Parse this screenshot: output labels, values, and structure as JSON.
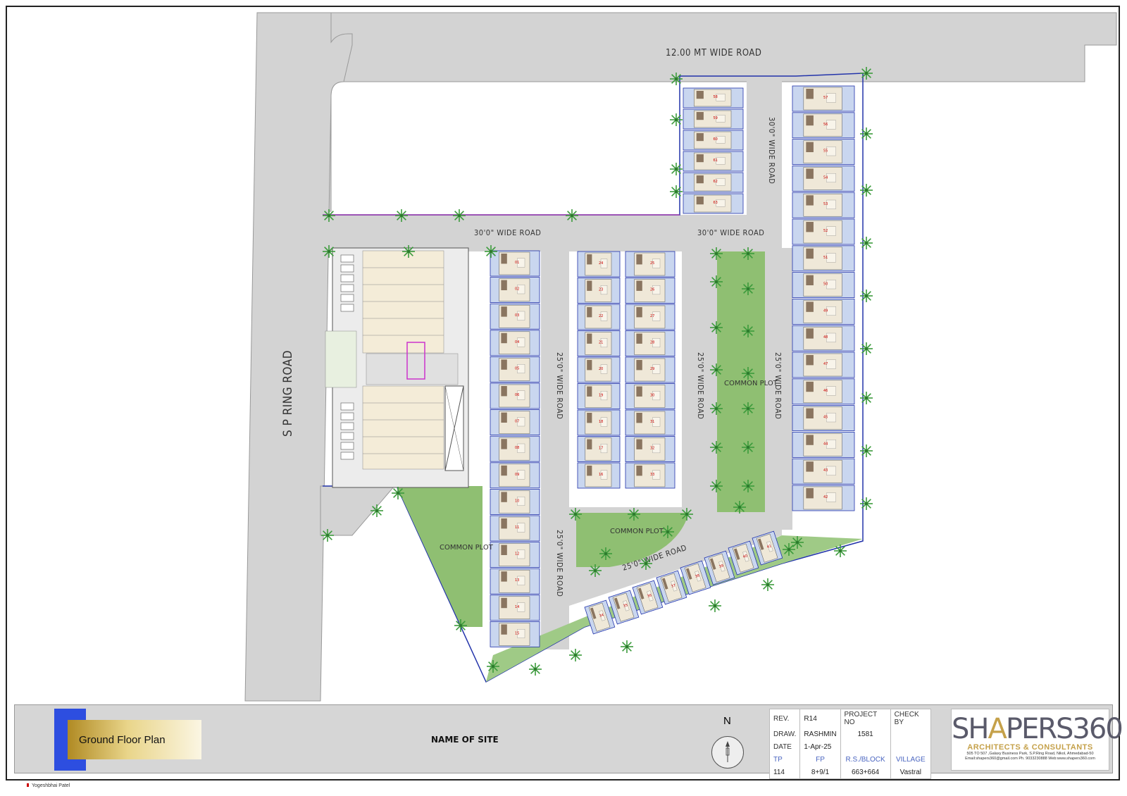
{
  "roads": {
    "top": "12.00 MT  WIDE ROAD",
    "left": "S P RING ROAD",
    "r30_right_vertical": "30'0\" WIDE ROAD",
    "r30_left": "30'0\" WIDE ROAD",
    "r30_mid": "30'0\" WIDE ROAD",
    "r25_a": "25'0\" WIDE ROAD",
    "r25_b": "25'0\" WIDE ROAD",
    "r25_c": "25'0\" WIDE ROAD",
    "r25_d": "25'0\" WIDE ROAD",
    "r25_e": "25'0\" WIDE ROAD"
  },
  "plots": {
    "common_plot_1": "COMMON PLOT",
    "common_plot_2": "COMMON PLOT",
    "common_plot_3": "COMMON PLOT"
  },
  "units": {
    "col1": [
      "01",
      "02",
      "03",
      "04",
      "05",
      "06",
      "07",
      "08",
      "09",
      "10",
      "11",
      "12",
      "13",
      "14",
      "15"
    ],
    "col2": [
      "24",
      "23",
      "22",
      "21",
      "20",
      "19",
      "18",
      "17",
      "16"
    ],
    "col3": [
      "25",
      "26",
      "27",
      "28",
      "29",
      "30",
      "31",
      "32",
      "33"
    ],
    "col_top": [
      "58",
      "59",
      "60",
      "61",
      "62",
      "63"
    ],
    "col_right": [
      "57",
      "56",
      "55",
      "54",
      "53",
      "52",
      "51",
      "50",
      "49",
      "48",
      "47",
      "46",
      "45",
      "44",
      "43",
      "42"
    ],
    "diag": [
      "34",
      "35",
      "36",
      "37",
      "38",
      "39",
      "40",
      "41"
    ]
  },
  "title_block": {
    "sheet_title": "Ground Floor Plan",
    "site_name": "NAME OF SITE",
    "north": "N",
    "rev_label": "REV.",
    "rev": "R14",
    "draw_label": "DRAW.",
    "draw": "RASHMIN",
    "date_label": "DATE",
    "date": "1-Apr-25",
    "project_no_label": "PROJECT NO",
    "project_no": "1581",
    "check_by_label": "CHECK BY",
    "check_by": "",
    "tp_label": "TP",
    "tp": "114",
    "fp_label": "FP",
    "fp": "8+9/1",
    "rs_label": "R.S./BLOCK",
    "rs": "663+664",
    "village_label": "VILLAGE",
    "village": "Vastral",
    "firm_name_a": "SH",
    "firm_name_b": "A",
    "firm_name_c": "PERS360",
    "firm_tagline": "ARCHITECTS & CONSULTANTS",
    "firm_address": "505 TO 507 ,Galaxy Business Park, S.P.Ring Road, Nikol, Ahmedabad-50",
    "firm_contact": "Email:shapers360@gmail.com  Ph. 9033230888 Web:www.shapers360.com",
    "signer": "Yogeshbhai Patel"
  },
  "colors": {
    "road": "#d3d3d3",
    "green": "#8fbf72",
    "boundary": "#2233aa",
    "unit": "#efe8d8",
    "accent": "#c5a14a"
  }
}
